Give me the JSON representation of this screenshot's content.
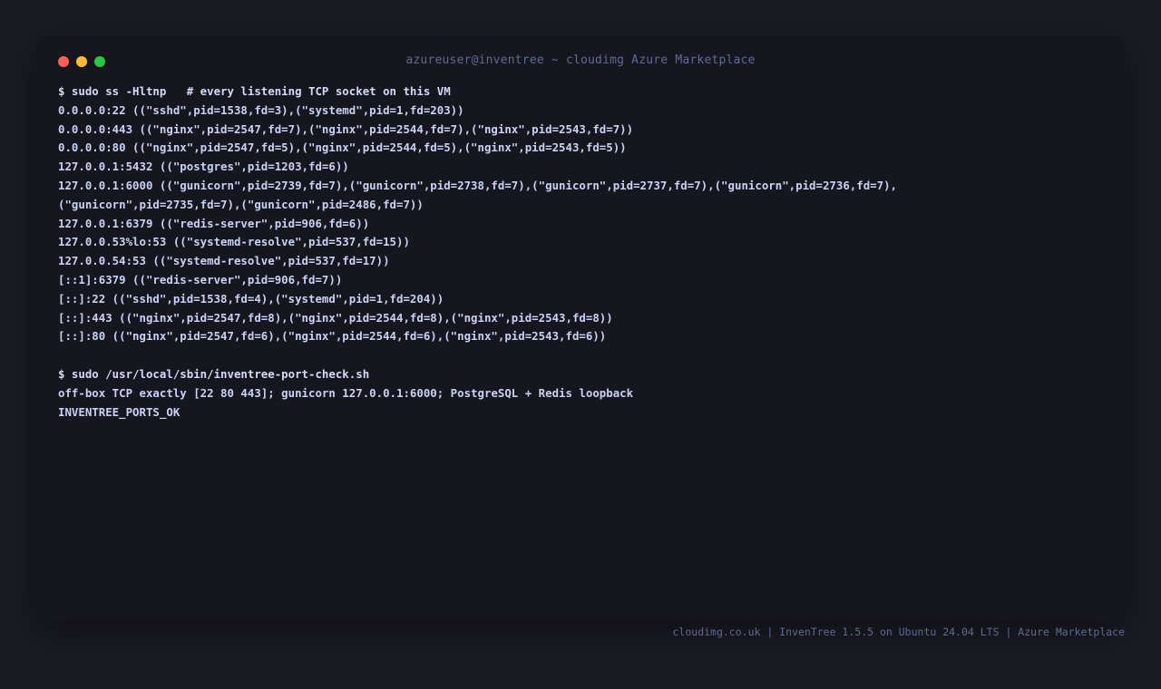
{
  "window": {
    "title": "azureuser@inventree ~ cloudimg Azure Marketplace"
  },
  "terminal": {
    "lines": [
      "$ sudo ss -Hltnp   # every listening TCP socket on this VM",
      "0.0.0.0:22 ((\"sshd\",pid=1538,fd=3),(\"systemd\",pid=1,fd=203))",
      "0.0.0.0:443 ((\"nginx\",pid=2547,fd=7),(\"nginx\",pid=2544,fd=7),(\"nginx\",pid=2543,fd=7))",
      "0.0.0.0:80 ((\"nginx\",pid=2547,fd=5),(\"nginx\",pid=2544,fd=5),(\"nginx\",pid=2543,fd=5))",
      "127.0.0.1:5432 ((\"postgres\",pid=1203,fd=6))",
      "127.0.0.1:6000 ((\"gunicorn\",pid=2739,fd=7),(\"gunicorn\",pid=2738,fd=7),(\"gunicorn\",pid=2737,fd=7),(\"gunicorn\",pid=2736,fd=7),",
      "(\"gunicorn\",pid=2735,fd=7),(\"gunicorn\",pid=2486,fd=7))",
      "127.0.0.1:6379 ((\"redis-server\",pid=906,fd=6))",
      "127.0.0.53%lo:53 ((\"systemd-resolve\",pid=537,fd=15))",
      "127.0.0.54:53 ((\"systemd-resolve\",pid=537,fd=17))",
      "[::1]:6379 ((\"redis-server\",pid=906,fd=7))",
      "[::]:22 ((\"sshd\",pid=1538,fd=4),(\"systemd\",pid=1,fd=204))",
      "[::]:443 ((\"nginx\",pid=2547,fd=8),(\"nginx\",pid=2544,fd=8),(\"nginx\",pid=2543,fd=8))",
      "[::]:80 ((\"nginx\",pid=2547,fd=6),(\"nginx\",pid=2544,fd=6),(\"nginx\",pid=2543,fd=6))",
      "",
      "$ sudo /usr/local/sbin/inventree-port-check.sh",
      "off-box TCP exactly [22 80 443]; gunicorn 127.0.0.1:6000; PostgreSQL + Redis loopback",
      "INVENTREE_PORTS_OK"
    ]
  },
  "footer": {
    "text": "cloudimg.co.uk | InvenTree 1.5.5 on Ubuntu 24.04 LTS | Azure Marketplace"
  },
  "colors": {
    "page_background": "#1b1b24",
    "window_background": "#16161e",
    "text": "#c9d2f4",
    "muted": "#5f6a95",
    "close": "#ff5f57",
    "minimize": "#febc2e",
    "maximize": "#28c840"
  }
}
